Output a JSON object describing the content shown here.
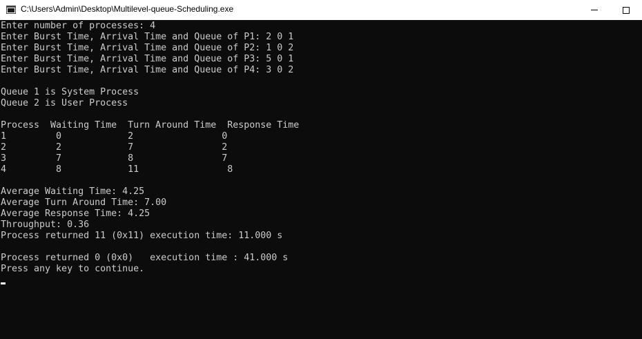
{
  "window": {
    "title": "C:\\Users\\Admin\\Desktop\\Multilevel-queue-Scheduling.exe"
  },
  "console": {
    "lines": [
      "Enter number of processes: 4",
      "Enter Burst Time, Arrival Time and Queue of P1: 2 0 1",
      "Enter Burst Time, Arrival Time and Queue of P2: 1 0 2",
      "Enter Burst Time, Arrival Time and Queue of P3: 5 0 1",
      "Enter Burst Time, Arrival Time and Queue of P4: 3 0 2",
      "",
      "Queue 1 is System Process",
      "Queue 2 is User Process",
      "",
      "Process  Waiting Time  Turn Around Time  Response Time",
      "1         0            2                0",
      "2         2            7                2",
      "3         7            8                7",
      "4         8            11                8",
      "",
      "Average Waiting Time: 4.25",
      "Average Turn Around Time: 7.00",
      "Average Response Time: 4.25",
      "Throughput: 0.36",
      "Process returned 11 (0x11) execution time: 11.000 s",
      "",
      "Process returned 0 (0x0)   execution time : 41.000 s",
      "Press any key to continue."
    ]
  },
  "colors": {
    "background": "#0c0c0c",
    "text": "#cccccc",
    "titlebar": "#ffffff"
  },
  "icons": {
    "app": "console-app-icon",
    "minimize": "minimize-icon",
    "maximize": "maximize-icon"
  }
}
